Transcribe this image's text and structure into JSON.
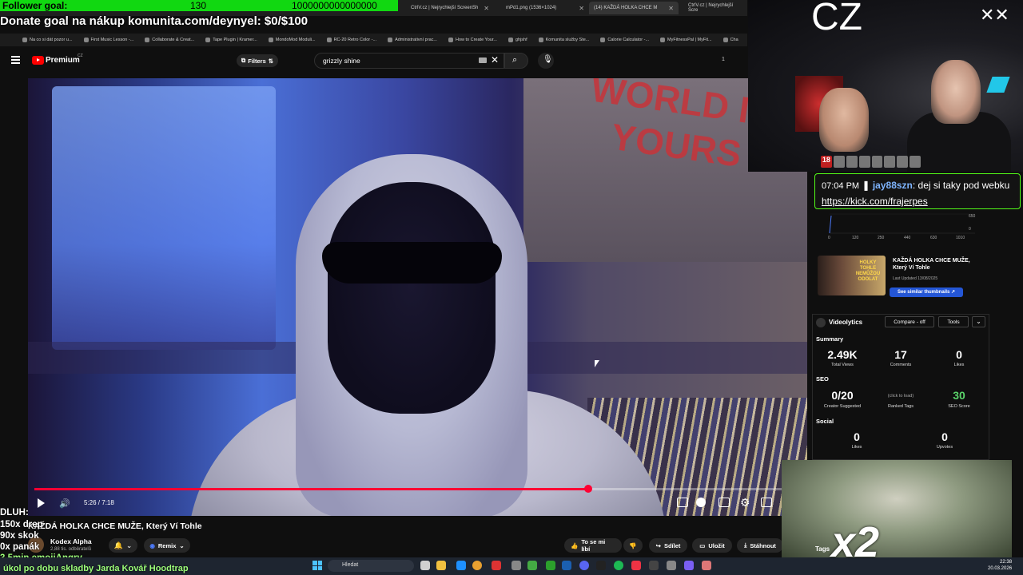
{
  "goal": {
    "label": "Follower goal:",
    "current": "130",
    "target": "1000000000000000"
  },
  "donate": "Donate goal na nákup komunita.com/deynyel: $0/$100",
  "tabs": [
    {
      "label": "CtrlV.cz | Nejrychlejší ScreenSh"
    },
    {
      "label": "mPd1.png (1536×1024)"
    },
    {
      "label": "(14) KAŽDÁ HOLKA CHCE M"
    },
    {
      "label": "CtrlV.cz | Nejrychlejší Scre"
    }
  ],
  "bookmarks": [
    "Na co si dát pozor u...",
    "First Music Lesson -...",
    "Collaborate & Creat...",
    "Tape Plugin | Kramer...",
    "MondoMod Moduli...",
    "RC-20 Retro Color -...",
    "Administrativní prac...",
    "How to Create Your...",
    "ghjshf",
    "Komunita služby Ste...",
    "Calorie Calculator -...",
    "MyFitnessPal | MyFit...",
    "Cha"
  ],
  "header": {
    "brand": "Premium",
    "region": "CZ",
    "filters_label": "Filters",
    "search_value": "grizzly shine",
    "right_info": "1"
  },
  "player": {
    "time": "5:26 / 7:18",
    "progress": 0.7415
  },
  "video": {
    "poster_text": "WORLD IS YOURS"
  },
  "below": {
    "title": "KAŽDÁ HOLKA CHCE MUŽE, Který Ví Tohle",
    "channel": "Kodex Alpha",
    "subs": "2,88 tis. odběratelů",
    "remix": "Remix",
    "like": "To se mi líbí",
    "share": "Sdílet",
    "save": "Uložit",
    "download": "Stáhnout"
  },
  "overlay": {
    "dluh": "DLUH:",
    "line1": "150x drep",
    "line2": "90x skok",
    "line3": "0x panák",
    "line4": "3.5min emojiAngry",
    "line5": "úkol po dobu skladby Jarda Kovář Hoodtrap"
  },
  "taskbar": {
    "search": "Hledat",
    "time": "22:38",
    "date": "20.03.2026"
  },
  "webcam": {
    "label": "CZ",
    "mark": "✕✕"
  },
  "chat": {
    "time": "07:04 PM",
    "user": "jay88szn",
    "text": ": dej si taky pod webku ",
    "link": "https://kick.com/frajerpes"
  },
  "mini_chart": {
    "ticks": [
      "0",
      "120",
      "250",
      "440",
      "630",
      "1010"
    ],
    "y1": "650",
    "y2": "0"
  },
  "similar": {
    "thumb_text": "HOLKY TOHLE NEMŮŽOU ODOLAT",
    "title": "KAŽDÁ HOLKA CHCE MUŽE, Který Ví Tohle",
    "updated": "Last Updated 13/08/2025",
    "button": "See similar thumbnails ↗"
  },
  "videolytics": {
    "name": "Videolytics",
    "compare": "Compare - off",
    "tools": "Tools",
    "summary_label": "Summary",
    "total_views": "2.49K",
    "total_views_label": "Total Views",
    "comments": "17",
    "comments_label": "Comments",
    "likes": "0",
    "likes_label": "Likes",
    "seo_label": "SEO",
    "creator_suggested": "0/20",
    "creator_suggested_label": "Creator Suggested",
    "ranked_tags": "(click to load)",
    "ranked_tags_label": "Ranked Tags",
    "seo_score": "30",
    "seo_score_label": "SEO Score",
    "social_label": "Social",
    "social_likes": "0",
    "social_likes_label": "Likes",
    "upvotes": "0",
    "upvotes_label": "Upvotes",
    "tags_label": "Tags"
  },
  "sticker": {
    "text": "x2"
  },
  "colors": {
    "accent_red": "#ff0033",
    "kick_green": "#53fc18",
    "seo_green": "#5ad36a"
  }
}
